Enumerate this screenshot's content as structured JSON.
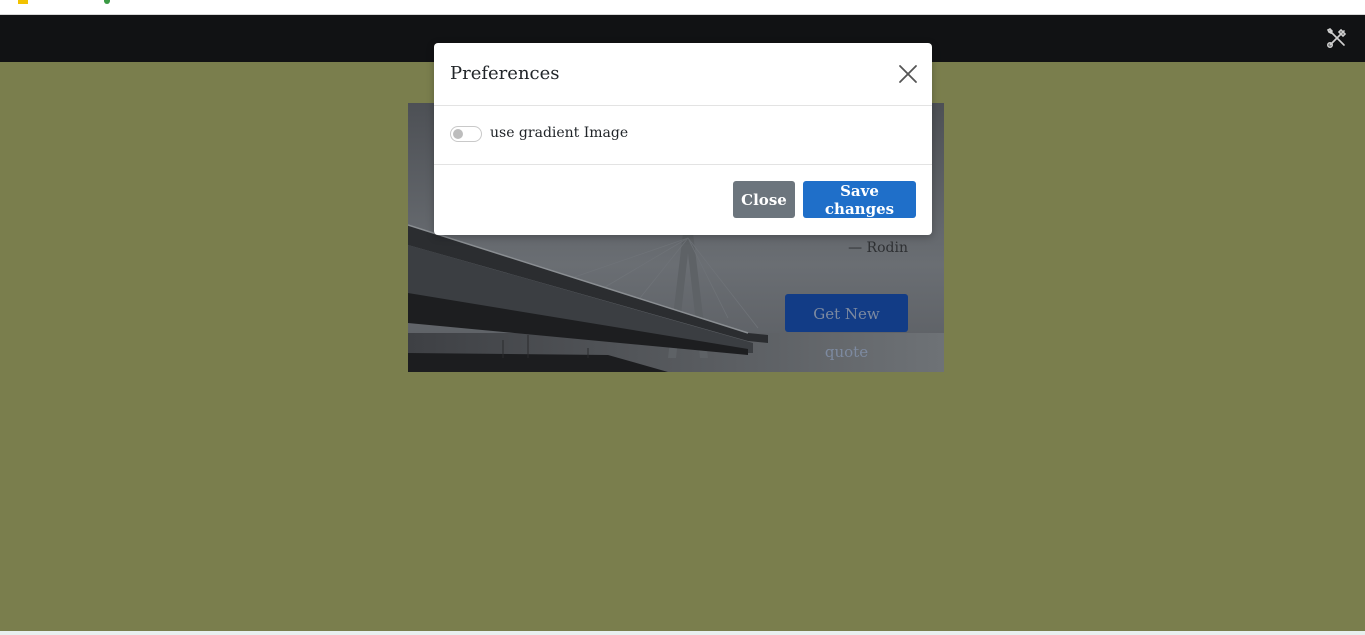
{
  "navbar": {
    "tools_icon": "tools-icon"
  },
  "quote_card": {
    "author": "— Rodin",
    "new_quote_label": "Get New quote"
  },
  "modal": {
    "title": "Preferences",
    "close_icon": "close-icon",
    "toggle_label": "use gradient Image",
    "toggle_checked": false,
    "close_button": "Close",
    "save_button": "Save changes"
  },
  "colors": {
    "page_bg": "#7a7e4d",
    "navbar_bg": "#111214",
    "primary": "#1f6fc9",
    "secondary": "#6c757d"
  }
}
